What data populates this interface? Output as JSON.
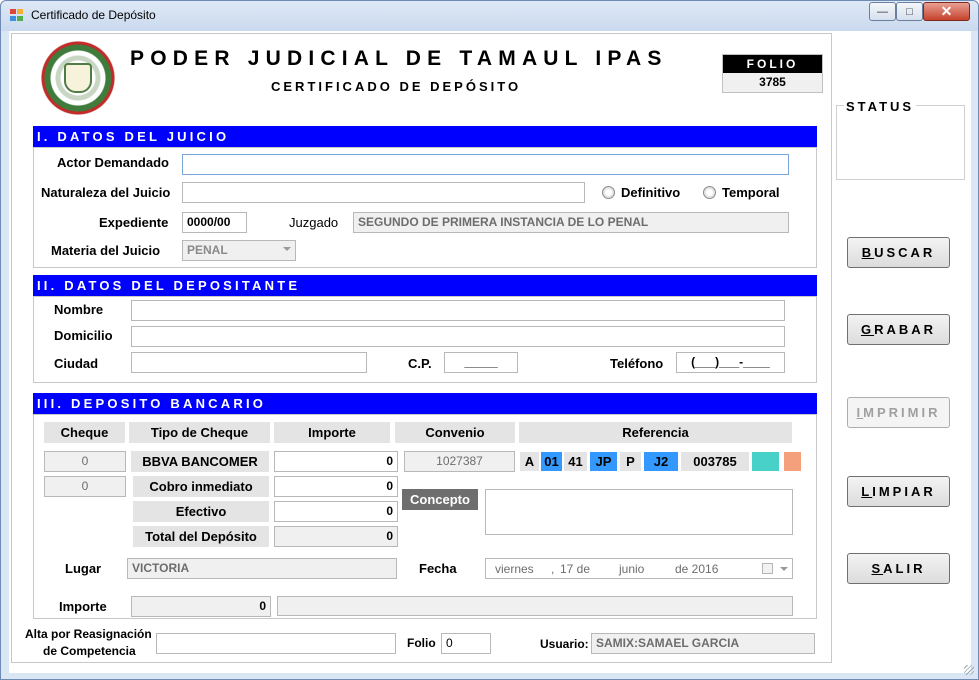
{
  "window": {
    "title": "Certificado de Depósito",
    "minimize": "—",
    "maximize": "□",
    "close": "✕"
  },
  "header": {
    "title": "PODER JUDICIAL DE TAMAUL IPAS",
    "subtitle": "CERTIFICADO DE DEPÓSITO",
    "folio_label": "FOLIO",
    "folio_value": "3785"
  },
  "juicio": {
    "section_title": "I. DATOS DEL JUICIO",
    "actor_label": "Actor Demandado",
    "actor_value": "",
    "naturaleza_label": "Naturaleza del Juicio",
    "naturaleza_value": "",
    "definitivo_label": "Definitivo",
    "temporal_label": "Temporal",
    "expediente_label": "Expediente",
    "expediente_value": "0000/00",
    "juzgado_label": "Juzgado",
    "juzgado_value": "SEGUNDO DE PRIMERA INSTANCIA DE LO PENAL",
    "materia_label": "Materia del Juicio",
    "materia_value": "PENAL"
  },
  "depositante": {
    "section_title": "II. DATOS DEL DEPOSITANTE",
    "nombre_label": "Nombre",
    "domicilio_label": "Domicilio",
    "ciudad_label": "Ciudad",
    "cp_label": "C.P.",
    "cp_value": "_____",
    "telefono_label": "Teléfono",
    "telefono_value": "(___)___-____"
  },
  "deposito": {
    "section_title": "III. DEPOSITO BANCARIO",
    "col_cheque": "Cheque",
    "col_tipo": "Tipo de Cheque",
    "col_importe": "Importe",
    "col_convenio": "Convenio",
    "col_referencia": "Referencia",
    "cheque1": "0",
    "cheque2": "0",
    "tipo1": "BBVA BANCOMER",
    "tipo2": "Cobro inmediato",
    "tipo3": "Efectivo",
    "tipo4": "Total del Depósito",
    "importe1": "0",
    "importe2": "0",
    "importe3": "0",
    "importe4": "0",
    "convenio_value": "1027387",
    "concepto_label": "Concepto",
    "concepto_value": "",
    "ref": [
      "A",
      "01",
      "41",
      "JP",
      "P",
      "J2",
      "003785"
    ],
    "lugar_label": "Lugar",
    "lugar_value": "VICTORIA",
    "fecha_label": "Fecha",
    "fecha_dia": "viernes",
    "fecha_sep": ",",
    "fecha_num": "17 de",
    "fecha_mes": "junio",
    "fecha_anio": "de 2016",
    "importe_label": "Importe",
    "importe_total": "0",
    "importe_letra": ""
  },
  "footer": {
    "alta_label_1": "Alta por Reasignación",
    "alta_label_2": "de Competencia",
    "alta_value": "",
    "folio_label": "Folio",
    "folio_value": "0",
    "usuario_label": "Usuario:",
    "usuario_value": "SAMIX:SAMAEL GARCIA"
  },
  "side": {
    "status_label": "STATUS",
    "status_value": "",
    "buscar_u": "B",
    "buscar_rest": "USCAR",
    "grabar_u": "G",
    "grabar_rest": "RABAR",
    "imprimir_u": "I",
    "imprimir_rest": "MPRIMIR",
    "limpiar_u": "L",
    "limpiar_rest": "IMPIAR",
    "salir_u": "S",
    "salir_rest": "ALIR"
  },
  "colors": {
    "section_bar": "#0000ff",
    "ref_blue": "#3399ff",
    "ref_teal": "#47d1c9",
    "ref_salmon": "#f4a07d",
    "concepto_bg": "#6e6e6e"
  }
}
